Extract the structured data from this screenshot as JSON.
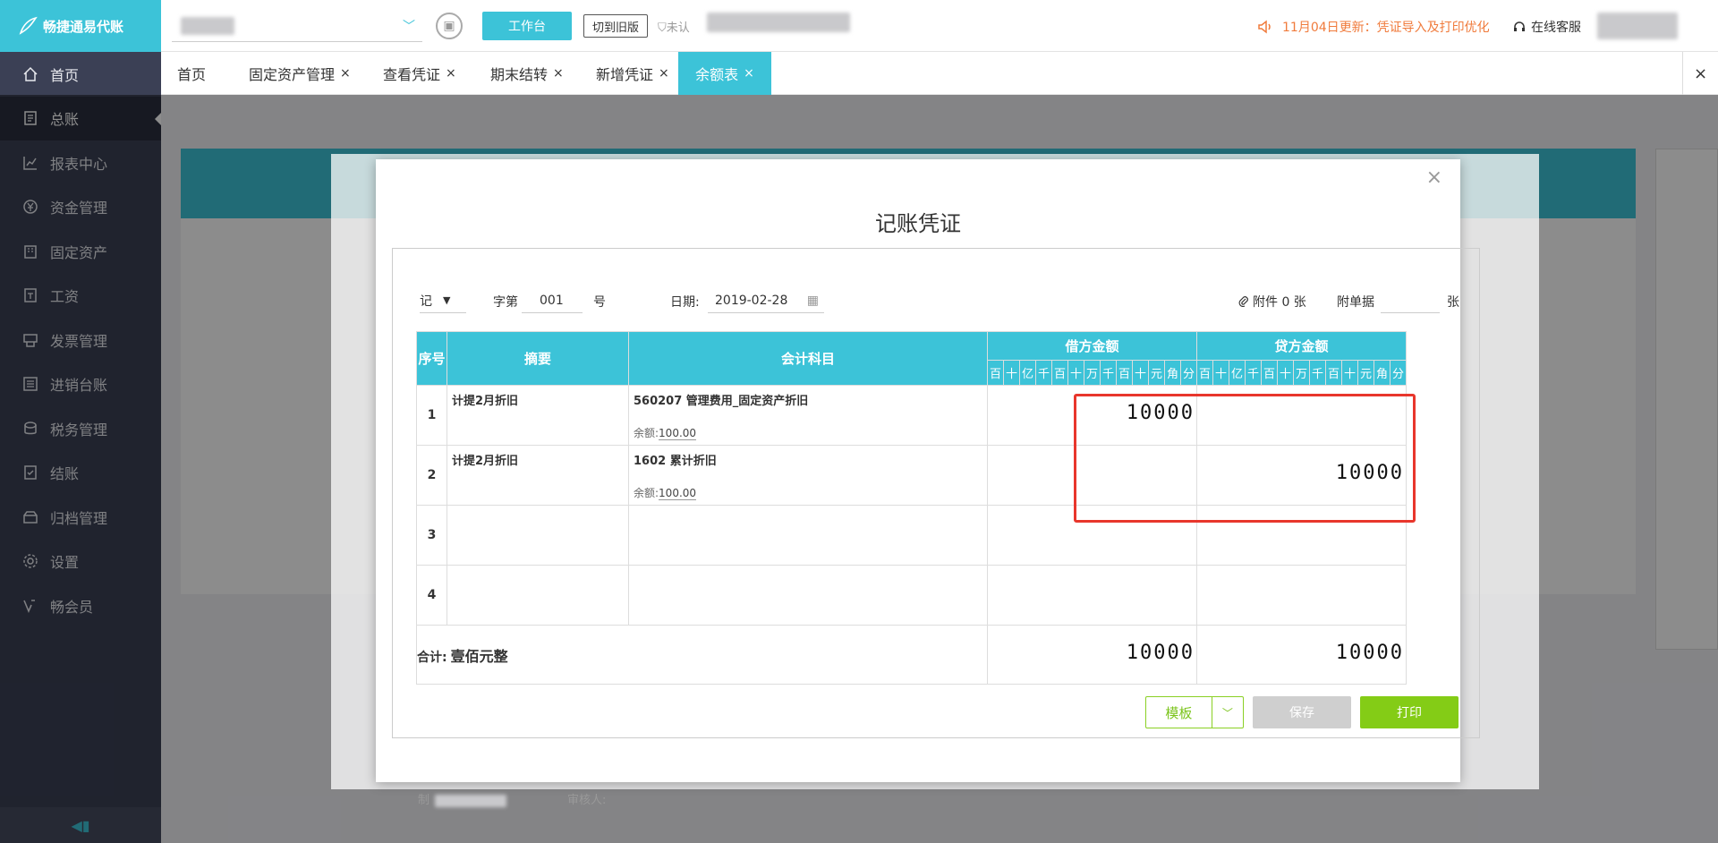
{
  "app": {
    "logo_text": "畅捷通易代账"
  },
  "sidebar": {
    "items": [
      {
        "label": "首页",
        "icon": "home-icon"
      },
      {
        "label": "总账",
        "icon": "ledger-icon",
        "active": true
      },
      {
        "label": "报表中心",
        "icon": "chart-icon"
      },
      {
        "label": "资金管理",
        "icon": "money-icon"
      },
      {
        "label": "固定资产",
        "icon": "building-icon"
      },
      {
        "label": "工资",
        "icon": "salary-icon"
      },
      {
        "label": "发票管理",
        "icon": "invoice-icon"
      },
      {
        "label": "进销台账",
        "icon": "inventory-icon"
      },
      {
        "label": "税务管理",
        "icon": "tax-icon"
      },
      {
        "label": "结账",
        "icon": "closing-icon"
      },
      {
        "label": "归档管理",
        "icon": "archive-icon"
      },
      {
        "label": "设置",
        "icon": "gear-icon"
      },
      {
        "label": "畅会员",
        "icon": "vip-icon"
      }
    ]
  },
  "header": {
    "workbench": "工作台",
    "switch_old": "切到旧版",
    "unauth": "未认",
    "notice": "11月04日更新：凭证导入及打印优化",
    "service": "在线客服"
  },
  "tabs": [
    {
      "label": "首页"
    },
    {
      "label": "固定资产管理",
      "close": "×"
    },
    {
      "label": "查看凭证",
      "close": "×"
    },
    {
      "label": "期末结转",
      "close": "×"
    },
    {
      "label": "新增凭证",
      "close": "×"
    },
    {
      "label": "余额表",
      "close": "×",
      "active": true
    }
  ],
  "modal": {
    "title": "记账凭证",
    "voucher_type": "记",
    "word_label": "字第",
    "number": "001",
    "hao": "号",
    "date_label": "日期:",
    "date": "2019-02-28",
    "attachments": "附件 0 张",
    "voucher_doc_label": "附单据",
    "zhang": "张",
    "columns": {
      "index": "序号",
      "summary": "摘要",
      "account": "会计科目",
      "debit": "借方金额",
      "credit": "贷方金额"
    },
    "digit_units": [
      "百",
      "十",
      "亿",
      "千",
      "百",
      "十",
      "万",
      "千",
      "百",
      "十",
      "元",
      "角",
      "分"
    ],
    "rows": [
      {
        "index": "1",
        "summary": "计提2月折旧",
        "account": "560207 管理费用_固定资产折旧",
        "balance_label": "余额:",
        "balance": "100.00",
        "debit": "10000",
        "credit": ""
      },
      {
        "index": "2",
        "summary": "计提2月折旧",
        "account": "1602 累计折旧",
        "balance_label": "余额:",
        "balance": "100.00",
        "debit": "",
        "credit": "10000"
      },
      {
        "index": "3",
        "summary": "",
        "account": "",
        "debit": "",
        "credit": ""
      },
      {
        "index": "4",
        "summary": "",
        "account": "",
        "debit": "",
        "credit": ""
      }
    ],
    "total_label": "合计:",
    "total_words": "壹佰元整",
    "total_debit": "10000",
    "total_credit": "10000",
    "maker_label": "制",
    "auditor_label": "审核人:",
    "buttons": {
      "template": "模板",
      "save": "保存",
      "print": "打印"
    }
  },
  "colors": {
    "accent": "#3cc3d8",
    "highlight": "#e8362c",
    "print": "#84cc16"
  }
}
